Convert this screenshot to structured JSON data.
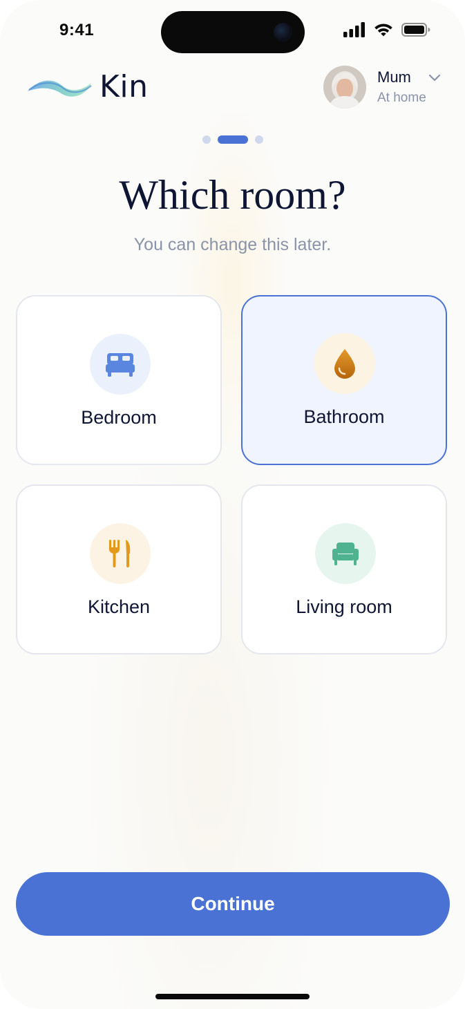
{
  "status_bar": {
    "time": "9:41"
  },
  "header": {
    "app_name": "Kin",
    "profile": {
      "name": "Mum",
      "status": "At home"
    }
  },
  "progress": {
    "steps": 3,
    "current_step": 2
  },
  "main": {
    "title": "Which room?",
    "subtitle": "You can change this later.",
    "rooms": [
      {
        "label": "Bedroom",
        "icon": "bed-icon",
        "selected": false,
        "icon_color": "#5a86e0",
        "icon_bg": "#eaf1fd"
      },
      {
        "label": "Bathroom",
        "icon": "water-drop-icon",
        "selected": true,
        "icon_color": "#c57a12",
        "icon_bg": "#fdf3e2"
      },
      {
        "label": "Kitchen",
        "icon": "fork-knife-icon",
        "selected": false,
        "icon_color": "#e39a1c",
        "icon_bg": "#fdf3e4"
      },
      {
        "label": "Living room",
        "icon": "armchair-icon",
        "selected": false,
        "icon_color": "#4fb391",
        "icon_bg": "#e6f6ef"
      }
    ]
  },
  "footer": {
    "continue_label": "Continue"
  },
  "colors": {
    "accent": "#4a72d4",
    "text": "#0f1633",
    "muted": "#8a93a8"
  }
}
